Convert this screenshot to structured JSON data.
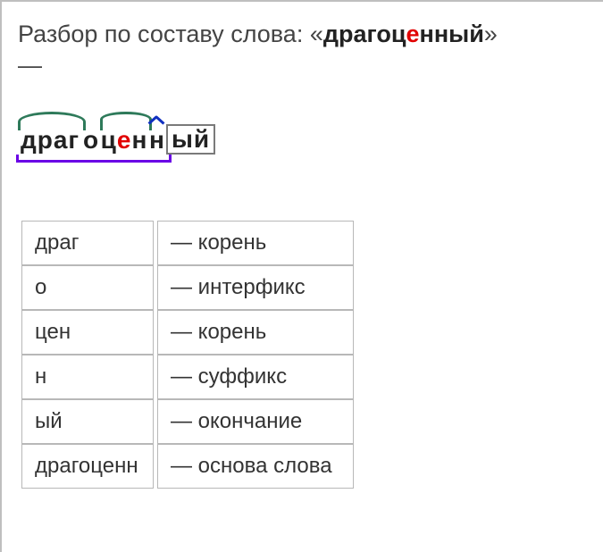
{
  "title": {
    "prefix": "Разбор по составу слова: «",
    "word_before_accent": "драгоц",
    "word_accent": "е",
    "word_after_accent": "нный",
    "suffix": "»",
    "dash_below": "—"
  },
  "diagram": {
    "segments": {
      "root1": "драг",
      "interfix": "о",
      "root2_before": "ц",
      "root2_accent": "е",
      "root2_after": "н",
      "suffix": "н",
      "ending": "ый"
    }
  },
  "table": {
    "rows": [
      {
        "part": "драг",
        "def": "— корень"
      },
      {
        "part": "о",
        "def": "— интерфикс"
      },
      {
        "part": "цен",
        "def": "— корень"
      },
      {
        "part": "н",
        "def": "— суффикс"
      },
      {
        "part": "ый",
        "def": "— окончание"
      },
      {
        "part": "драгоценн",
        "def": "— основа слова"
      }
    ]
  }
}
